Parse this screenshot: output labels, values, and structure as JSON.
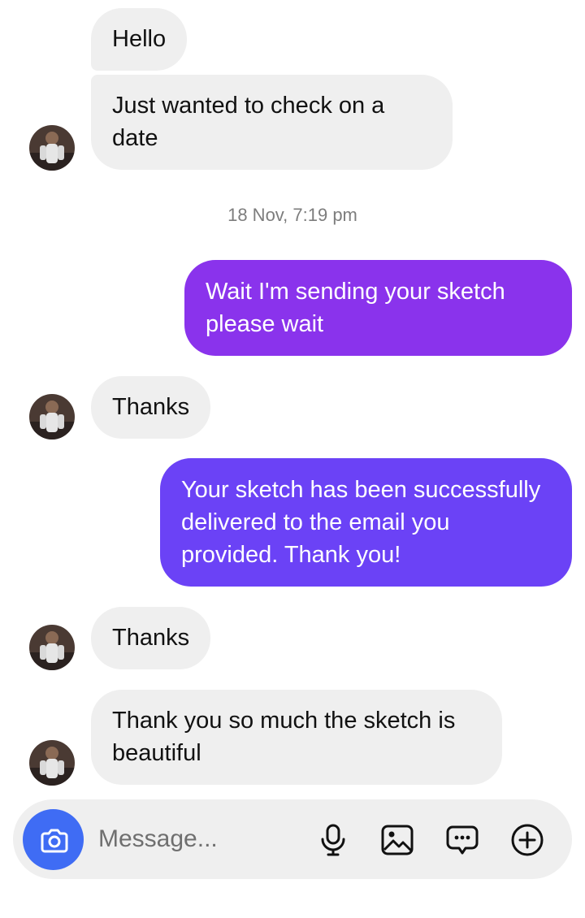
{
  "messages": [
    {
      "id": "m1",
      "direction": "incoming",
      "text": "Hello"
    },
    {
      "id": "m2",
      "direction": "incoming",
      "text": "Just wanted to check on a date"
    },
    {
      "id": "m3",
      "direction": "outgoing",
      "text": "Wait I'm sending your sketch please wait"
    },
    {
      "id": "m4",
      "direction": "incoming",
      "text": "Thanks"
    },
    {
      "id": "m5",
      "direction": "outgoing",
      "text": "Your sketch has been successfully delivered to the email you provided. Thank you!"
    },
    {
      "id": "m6",
      "direction": "incoming",
      "text": "Thanks"
    },
    {
      "id": "m7",
      "direction": "incoming",
      "text": "Thank you so much the sketch is beautiful"
    }
  ],
  "timestamp": "18 Nov, 7:19 pm",
  "composer": {
    "placeholder": "Message...",
    "icons": [
      "camera-icon",
      "microphone-icon",
      "image-icon",
      "sticker-icon",
      "plus-icon"
    ]
  },
  "colors": {
    "incoming_bubble": "#efefef",
    "outgoing_bubble_1": "#8a33ec",
    "outgoing_bubble_2": "#6b42f6",
    "camera_button": "#3f6cf4"
  }
}
